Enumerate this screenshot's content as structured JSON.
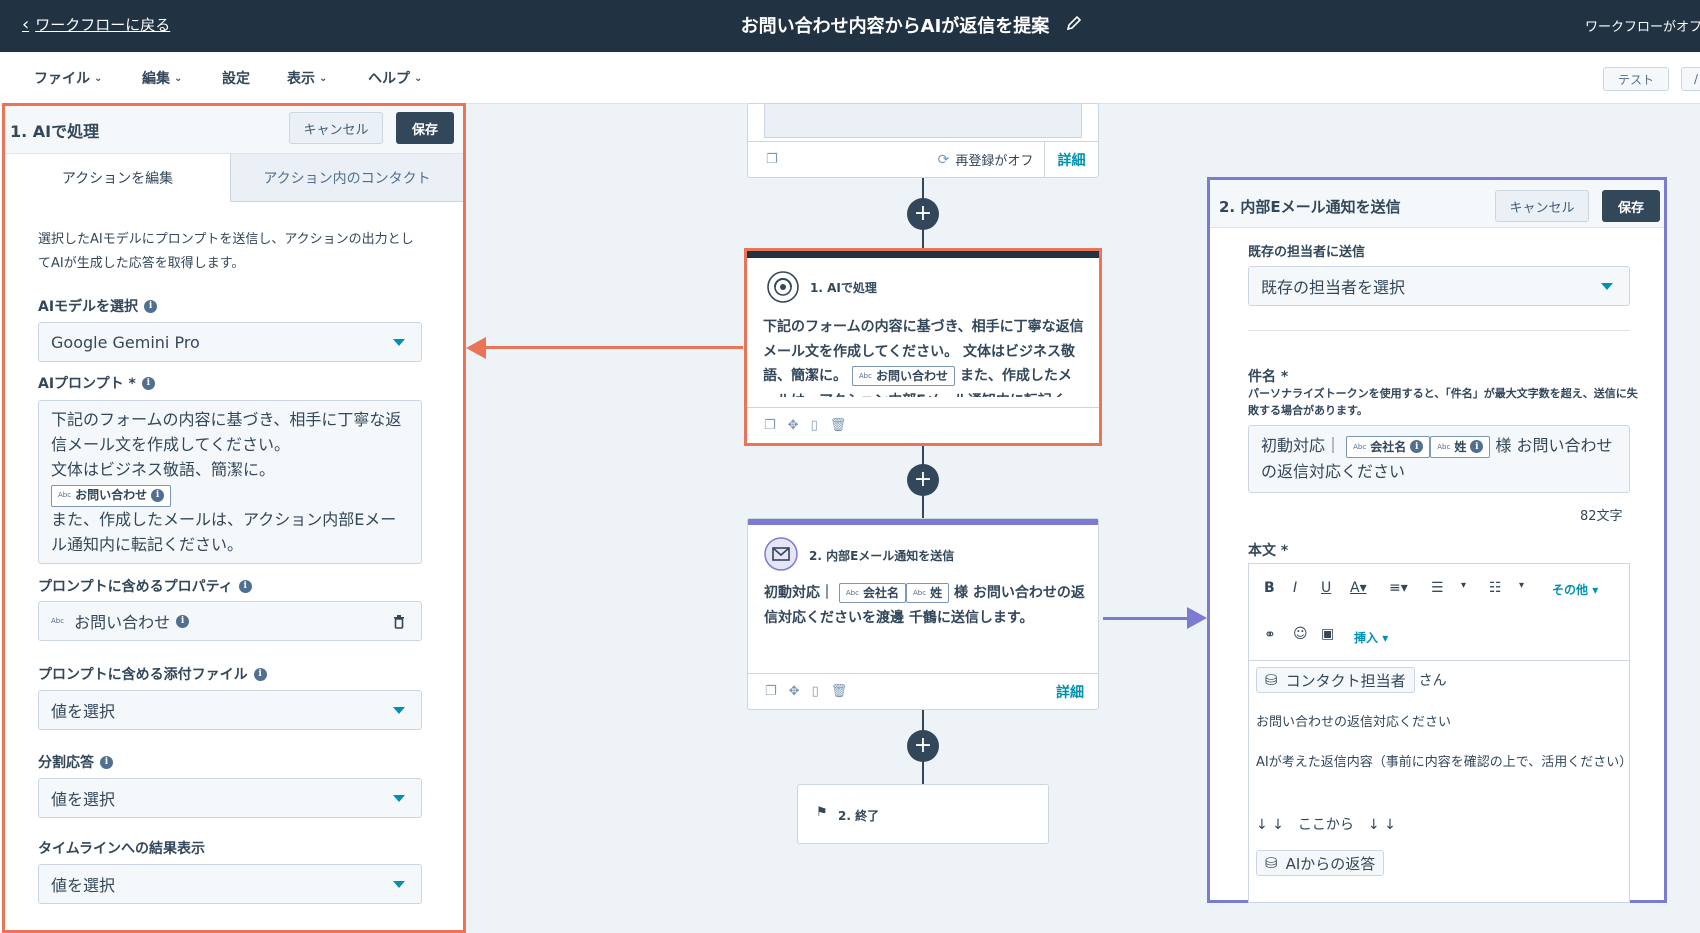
{
  "topbar": {
    "back_label": "ワークフローに戻る",
    "title": "お問い合わせ内容からAIが返信を提案",
    "status": "ワークフローがオフ"
  },
  "menu": {
    "items": [
      "ファイル",
      "編集",
      "設定",
      "表示",
      "ヘルプ"
    ],
    "test_button": "テスト",
    "extra_button": "/"
  },
  "left_panel": {
    "title": "1. AIで処理",
    "cancel": "キャンセル",
    "save": "保存",
    "tabs": [
      "アクションを編集",
      "アクション内のコンタクト"
    ],
    "description": "選択したAIモデルにプロンプトを送信し、アクションの出力としてAIが生成した応答を取得します。",
    "model_label": "AIモデルを選択",
    "model_value": "Google Gemini Pro",
    "prompt_label": "AIプロンプト *",
    "prompt_line1": "下記のフォームの内容に基づき、相手に丁寧な返信メール文を作成してください。",
    "prompt_line2": "文体はビジネス敬語、簡潔に。",
    "prompt_token": "お問い合わせ",
    "prompt_line3": "また、作成したメールは、アクション内部Eメール通知内に転記ください。",
    "props_label": "プロンプトに含めるプロパティ",
    "props_value": "お問い合わせ",
    "attach_label": "プロンプトに含める添付ファイル",
    "attach_value": "値を選択",
    "split_label": "分割応答",
    "split_value": "値を選択",
    "timeline_label": "タイムラインへの結果表示",
    "timeline_value": "値を選択",
    "abc": "Abc"
  },
  "canvas": {
    "top_card": {
      "reenroll": "再登録がオフ",
      "detail": "詳細"
    },
    "ai_card": {
      "title": "1. AIで処理",
      "text1": "下記のフォームの内容に基づき、相手に丁寧な返信メール文を作成してください。 文体はビジネス敬語、簡潔に。",
      "token": "お問い合わせ",
      "text2": "また、作成したメールは、アクション内部Eメール通知内に転記く"
    },
    "email_card": {
      "title": "2. 内部Eメール通知を送信",
      "prefix": "初動対応｜",
      "token1": "会社名",
      "token2": "姓",
      "suffix": "様 お問い合わせの返信対応くださいを渡邊 千鶴に送信します。",
      "detail": "詳細"
    },
    "end_card": {
      "title": "2. 終了"
    },
    "plus": "+"
  },
  "right_panel": {
    "title": "2. 内部Eメール通知を送信",
    "cancel": "キャンセル",
    "save": "保存",
    "owner_label": "既存の担当者に送信",
    "owner_value": "既存の担当者を選択",
    "subject_label": "件名 *",
    "subject_help": "パーソナライズトークンを使用すると、「件名」が最大文字数を超え、送信に失敗する場合があります。",
    "subject_prefix": "初動対応｜",
    "subject_token1": "会社名",
    "subject_token2": "姓",
    "subject_suffix": "様 お問い合わせの返信対応ください",
    "char_count": "82文字",
    "body_label": "本文 *",
    "toolbar_more": "その他",
    "toolbar_insert": "挿入",
    "body_chip1": "コンタクト担当者",
    "body_san": "さん",
    "body_line1": "お問い合わせの返信対応ください",
    "body_line2": "AIが考えた返信内容（事前に内容を確認の上で、活用ください）",
    "body_line3": "↓ ↓　ここから　↓ ↓",
    "body_chip2": "AIからの返答"
  },
  "colors": {
    "nav": "#213343",
    "highlight_orange": "#ea7457",
    "highlight_purple": "#7b7bd1",
    "accent": "#0091ae"
  }
}
